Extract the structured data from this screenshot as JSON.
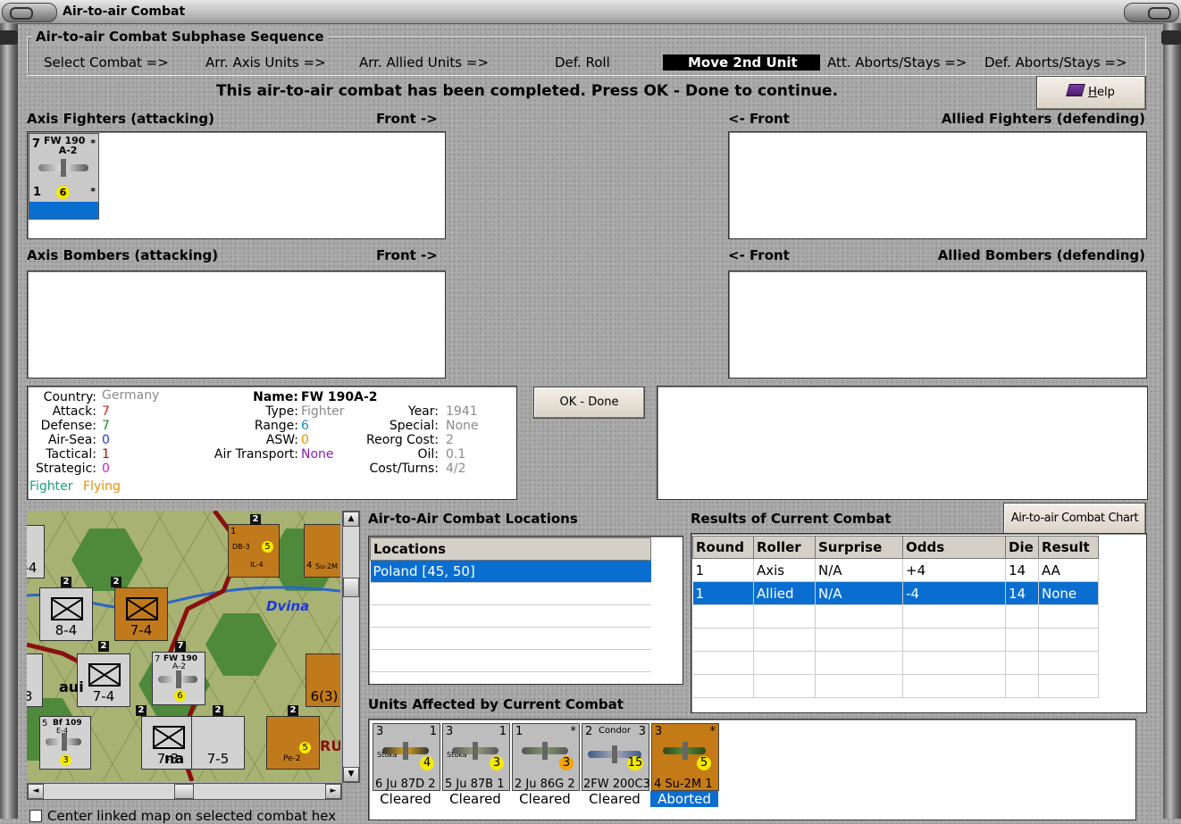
{
  "window": {
    "title": "Air-to-air Combat"
  },
  "sequence": {
    "title": "Air-to-air Combat Subphase Sequence",
    "steps": [
      "Select Combat =>",
      "Arr. Axis Units =>",
      "Arr. Allied Units =>",
      "Def. Roll",
      "Move 2nd Unit",
      "Att. Aborts/Stays =>",
      "Def. Aborts/Stays =>"
    ],
    "active_step": "Move 2nd Unit"
  },
  "banner": "This air-to-air combat has been completed.  Press OK - Done to continue.",
  "help_button": {
    "label_underlined": "H",
    "label_rest": "elp"
  },
  "boxes": {
    "axis_fighters": "Axis Fighters (attacking)",
    "axis_bombers": "Axis Bombers (attacking)",
    "allied_fighters": "Allied Fighters (defending)",
    "allied_bombers": "Allied Bombers (defending)",
    "front_right": "Front ->",
    "front_left": "<- Front"
  },
  "axis_fighter_counter": {
    "attack": "7",
    "name_line1": "FW 190",
    "name_line2": "A-2",
    "star": "*",
    "tactical": "1",
    "range": "6"
  },
  "unit_info": {
    "country_label": "Country:",
    "country": "Germany",
    "attack_label": "Attack:",
    "attack": "7",
    "defense_label": "Defense:",
    "defense": "7",
    "air_sea_label": "Air-Sea:",
    "air_sea": "0",
    "tactical_label": "Tactical:",
    "tactical": "1",
    "strategic_label": "Strategic:",
    "strategic": "0",
    "status_type": "Fighter",
    "status_flying": "Flying",
    "name_label": "Name:",
    "name": "FW 190A-2",
    "type_label": "Type:",
    "type": "Fighter",
    "range_label": "Range:",
    "range": "6",
    "asw_label": "ASW:",
    "asw": "0",
    "air_transport_label": "Air Transport:",
    "air_transport": "None",
    "year_label": "Year:",
    "year": "1941",
    "special_label": "Special:",
    "special": "None",
    "reorg_label": "Reorg Cost:",
    "reorg": "2",
    "oil_label": "Oil:",
    "oil": "0.1",
    "cost_label": "Cost/Turns:",
    "cost": "4/2",
    "colors": {
      "attack": "#d42020",
      "defense": "#1a8a1a",
      "air_sea": "#1a3adc",
      "tactical": "#c80000",
      "strategic": "#d020d0",
      "range": "#1a8fd0",
      "asw": "#f08c00",
      "air_transport": "#8c1ab4",
      "fighter": "#18a080",
      "flying": "#f08c00",
      "gray": "#8a8a8a"
    }
  },
  "ok_done_button": "OK - Done",
  "map": {
    "river_label": "Dvina",
    "counters": [
      {
        "top": "XX",
        "val": "-4"
      },
      {
        "top": "xxx",
        "val": "8-4"
      },
      {
        "top": "XXXX",
        "val": "7-4"
      },
      {
        "top": "xxx",
        "val": "7-4"
      },
      {
        "top": "xxx",
        "val": "7-3"
      },
      {
        "top": "xxx",
        "val": "7-5"
      },
      {
        "top": "XXXX",
        "val": "6(3)"
      },
      {
        "top": "",
        "val": "2)3"
      }
    ],
    "air_counters": [
      {
        "name": "FW 190",
        "sub": "A-2",
        "att": "7",
        "range": "6"
      },
      {
        "name": "DB-3",
        "sub": "IL-4",
        "att": "1",
        "range": "5"
      },
      {
        "name": "Su-2M",
        "sub": "",
        "att": "4",
        "range": ""
      },
      {
        "name": "Bf 109",
        "sub": "E-4",
        "att": "5",
        "range": "3"
      },
      {
        "name": "Pe-2",
        "sub": "",
        "att": "",
        "range": "5"
      }
    ],
    "stack_counts": [
      "2",
      "2",
      "2",
      "7",
      "2",
      "2",
      "2",
      "2"
    ],
    "scroll_up": "▲",
    "scroll_down": "▼",
    "scroll_left": "◄",
    "scroll_right": "►",
    "fragments": {
      "aui": "aui",
      "na": "na",
      "ru": "RU"
    }
  },
  "center_map_checkbox": "Center linked map on selected combat hex",
  "locations": {
    "title": "Air-to-Air Combat Locations",
    "header": "Locations",
    "rows": [
      "Poland [45, 50]",
      "",
      "",
      "",
      ""
    ]
  },
  "results": {
    "title": "Results of Current Combat",
    "chart_button": "Air-to-air Combat Chart",
    "columns": [
      "Round",
      "Roller",
      "Surprise",
      "Odds",
      "Die",
      "Result"
    ],
    "rows": [
      [
        "1",
        "Axis",
        "N/A",
        "+4",
        "14",
        "AA"
      ],
      [
        "1",
        "Allied",
        "N/A",
        "-4",
        "14",
        "None"
      ],
      [
        "",
        "",
        "",
        "",
        "",
        ""
      ],
      [
        "",
        "",
        "",
        "",
        "",
        ""
      ],
      [
        "",
        "",
        "",
        "",
        "",
        ""
      ],
      [
        "",
        "",
        "",
        "",
        "",
        ""
      ]
    ]
  },
  "affected": {
    "title": "Units Affected by Current Combat",
    "units": [
      {
        "top_left": "3",
        "top_right": "1",
        "badge": "Stuka",
        "range": "4",
        "bottom": "6 Ju 87D 2",
        "status": "Cleared"
      },
      {
        "top_left": "3",
        "top_right": "1",
        "badge": "Stuka",
        "range": "3",
        "bottom": "5 Ju 87B 1",
        "status": "Cleared"
      },
      {
        "top_left": "1",
        "top_right": "*",
        "badge": "",
        "range": "3",
        "bottom": "2 Ju 86G 2",
        "status": "Cleared"
      },
      {
        "top_left": "2",
        "top_right": "3",
        "badge": "Condor",
        "range": "15",
        "bottom": "2FW 200C3",
        "status": "Cleared"
      },
      {
        "top_left": "3",
        "top_right": "*",
        "badge": "",
        "range": "5",
        "bottom": "4 Su-2M 1",
        "status": "Aborted"
      }
    ]
  }
}
